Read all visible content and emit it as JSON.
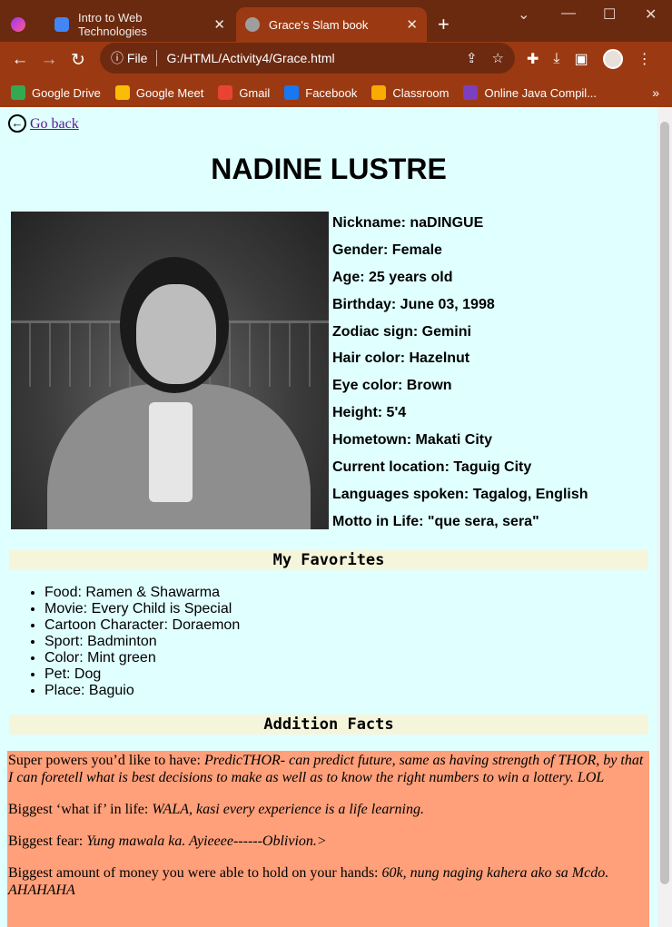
{
  "browser": {
    "tabs": [
      {
        "title": ""
      },
      {
        "title": "Intro to Web Technologies"
      },
      {
        "title": "Grace's Slam book"
      }
    ],
    "address": {
      "scheme": "File",
      "path": "G:/HTML/Activity4/Grace.html"
    },
    "bookmarks": [
      {
        "label": "Google Drive",
        "color": "#34a853"
      },
      {
        "label": "Google Meet",
        "color": "#fbbc04"
      },
      {
        "label": "Gmail",
        "color": "#ea4335"
      },
      {
        "label": "Facebook",
        "color": "#1877f2"
      },
      {
        "label": "Classroom",
        "color": "#f9ab00"
      },
      {
        "label": "Online Java Compil...",
        "color": "#7b3fbf"
      }
    ],
    "bookmarks_more": "»"
  },
  "page": {
    "back_label": " Go back",
    "title": "NADINE LUSTRE",
    "info": [
      "Nickname: naDINGUE",
      "Gender: Female",
      "Age: 25 years old",
      "Birthday: June 03, 1998",
      "Zodiac sign: Gemini",
      "Hair color: Hazelnut",
      "Eye color: Brown",
      "Height: 5'4",
      "Hometown: Makati City",
      "Current location: Taguig City",
      "Languages spoken: Tagalog, English",
      "Motto in Life: \"que sera, sera\""
    ],
    "favorites_heading": "My Favorites",
    "favorites": [
      "Food: Ramen & Shawarma",
      "Movie: Every Child is Special",
      "Cartoon Character: Doraemon",
      "Sport: Badminton",
      "Color: Mint green",
      "Pet: Dog",
      "Place: Baguio"
    ],
    "facts_heading": "Addition Facts",
    "facts": [
      {
        "q": "Super powers you’d like to have: ",
        "a": "PredicTHOR- can predict future, same as having strength of THOR, by that I can foretell what is best decisions to make as well as to know the right numbers to win a lottery. LOL"
      },
      {
        "q": "Biggest ‘what if’ in life: ",
        "a": "WALA, kasi every experience is a life learning."
      },
      {
        "q": "Biggest fear: ",
        "a": "Yung mawala ka. Ayieeee------Oblivion.>"
      },
      {
        "q": "Biggest amount of money you were able to hold on your hands: ",
        "a": "60k, nung naging kahera ako sa Mcdo. AHAHAHA"
      }
    ]
  }
}
